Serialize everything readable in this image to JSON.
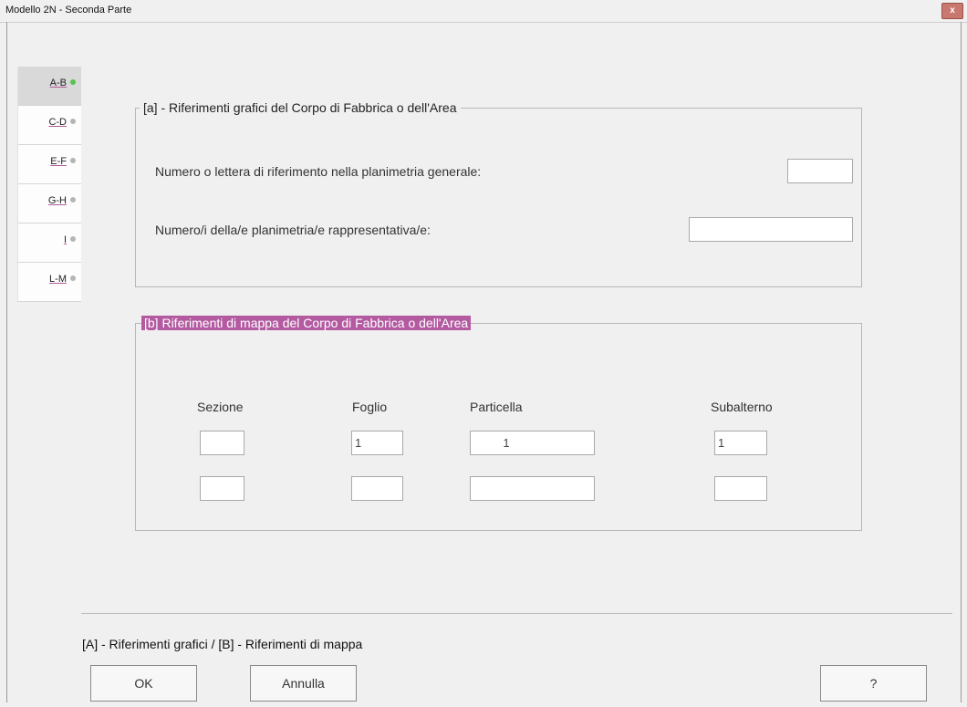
{
  "window": {
    "title": "Modello 2N - Seconda Parte",
    "close_label": "x"
  },
  "tabs": [
    {
      "label": "A-B",
      "status": "complete",
      "dot_color": "#58c24f"
    },
    {
      "label": "C-D",
      "status": "pending",
      "dot_color": "#b5b5b5"
    },
    {
      "label": "E-F",
      "status": "pending",
      "dot_color": "#b5b5b5"
    },
    {
      "label": "G-H",
      "status": "pending",
      "dot_color": "#b5b5b5"
    },
    {
      "label": "I",
      "status": "pending",
      "dot_color": "#b5b5b5"
    },
    {
      "label": "L-M",
      "status": "pending",
      "dot_color": "#b5b5b5"
    }
  ],
  "section_a": {
    "legend": "[a] - Riferimenti grafici del Corpo di Fabbrica o dell'Area",
    "label_numero": "Numero o lettera di riferimento nella planimetria generale:",
    "value_numero": "",
    "label_planimetria": "Numero/i della/e planimetria/e rappresentativa/e:",
    "value_planimetria": ""
  },
  "section_b": {
    "legend": "[b] Riferimenti di mappa del Corpo di Fabbrica o dell'Area",
    "highlight_color": "#b35aa1",
    "columns": [
      "Sezione",
      "Foglio",
      "Particella",
      "Subalterno"
    ],
    "rows": [
      {
        "sezione": "",
        "foglio": "1",
        "particella": "1",
        "subalterno": "1"
      },
      {
        "sezione": "",
        "foglio": "",
        "particella": "",
        "subalterno": ""
      }
    ]
  },
  "footer": {
    "legend_text": "[A] - Riferimenti grafici / [B] - Riferimenti di mappa",
    "ok_label": "OK",
    "cancel_label": "Annulla",
    "help_label": "?"
  }
}
